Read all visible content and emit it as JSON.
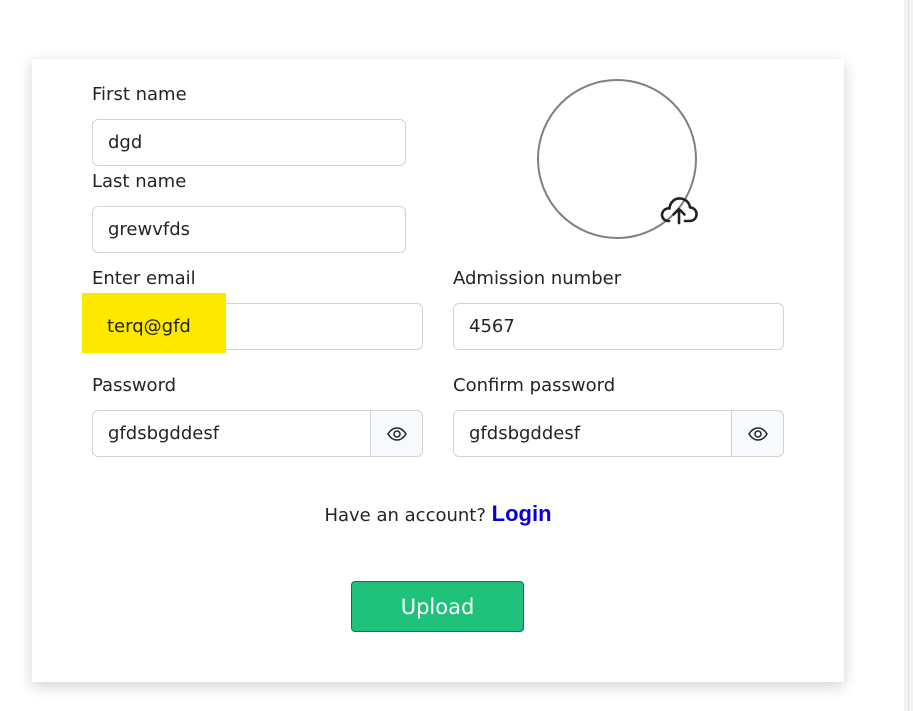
{
  "form": {
    "first_name": {
      "label": "First name",
      "value": "dgd"
    },
    "last_name": {
      "label": "Last name",
      "value": "grewvfds"
    },
    "email": {
      "label": "Enter email",
      "value": "terq@gfd"
    },
    "admission_number": {
      "label": "Admission number",
      "value": "4567"
    },
    "password": {
      "label": "Password",
      "value": "gfdsbgddesf"
    },
    "confirm_password": {
      "label": "Confirm password",
      "value": "gfdsbgddesf"
    }
  },
  "account": {
    "prompt": "Have an account?",
    "login_label": "Login"
  },
  "upload_button": {
    "label": "Upload"
  },
  "icons": {
    "avatar": "avatar-placeholder",
    "upload": "cloud-upload-icon",
    "show_password": "eye-icon"
  },
  "colors": {
    "highlight": "#ffe800",
    "upload_button": "#20c17a",
    "login_link": "#0a00d6"
  }
}
